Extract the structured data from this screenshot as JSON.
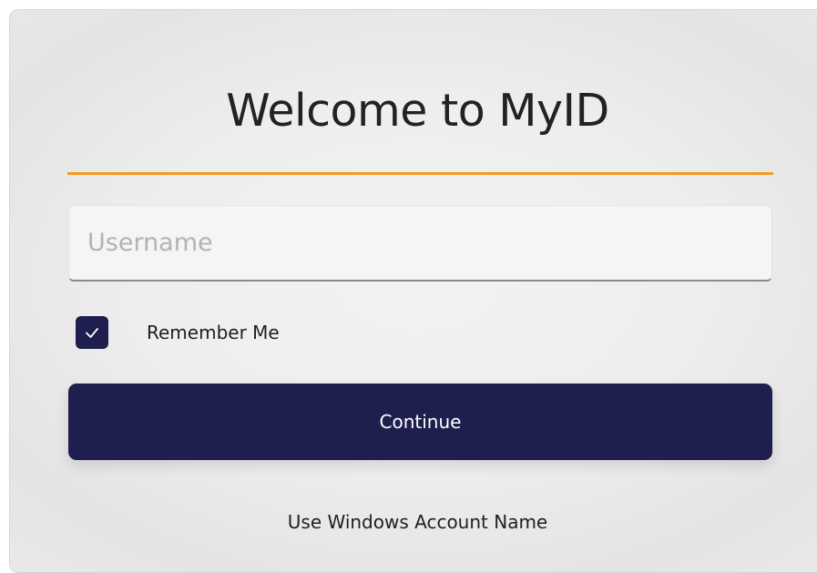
{
  "login": {
    "title": "Welcome to MyID",
    "username": {
      "value": "",
      "placeholder": "Username"
    },
    "remember_me": {
      "label": "Remember Me",
      "checked": true
    },
    "continue_label": "Continue",
    "windows_account_link": "Use Windows Account Name"
  },
  "colors": {
    "accent_rule": "#f39a1e",
    "primary": "#1e1f4e",
    "background": "#eeeeee"
  },
  "icons": {
    "checkbox": "checkmark-icon"
  }
}
